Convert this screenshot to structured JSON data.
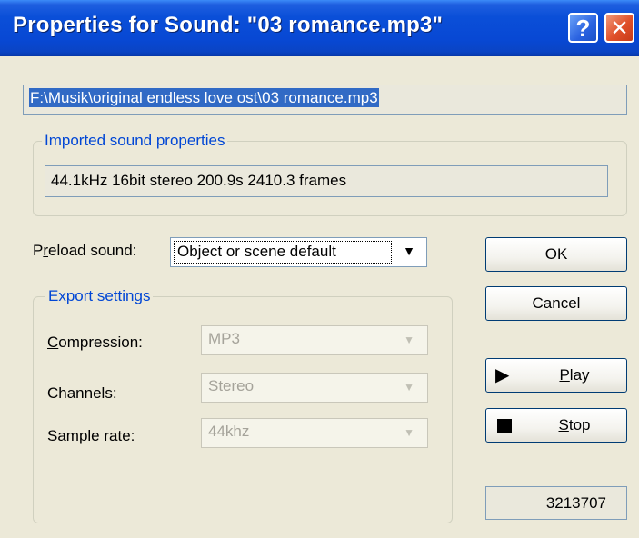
{
  "window": {
    "title": "Properties for Sound: \"03 romance.mp3\"",
    "help_glyph": "?",
    "close_glyph": "✕"
  },
  "file_path": "F:\\Musik\\original endless love ost\\03 romance.mp3",
  "imported": {
    "legend": "Imported sound properties",
    "properties": "44.1kHz 16bit stereo 200.9s 2410.3 frames"
  },
  "preload": {
    "label_prefix": "P",
    "label_underlined": "r",
    "label_rest": "eload sound:",
    "value": "Object or scene default"
  },
  "export": {
    "legend": "Export settings",
    "compression": {
      "label_underlined": "C",
      "label_rest": "ompression:",
      "value": "MP3"
    },
    "channels": {
      "label": "Channels:",
      "value": "Stereo"
    },
    "sample_rate": {
      "label": "Sample rate:",
      "value": "44khz"
    }
  },
  "buttons": {
    "ok": "OK",
    "cancel": "Cancel",
    "play_underlined": "P",
    "play_rest": "lay",
    "stop_underlined": "S",
    "stop_rest": "top"
  },
  "counter": "3213707"
}
